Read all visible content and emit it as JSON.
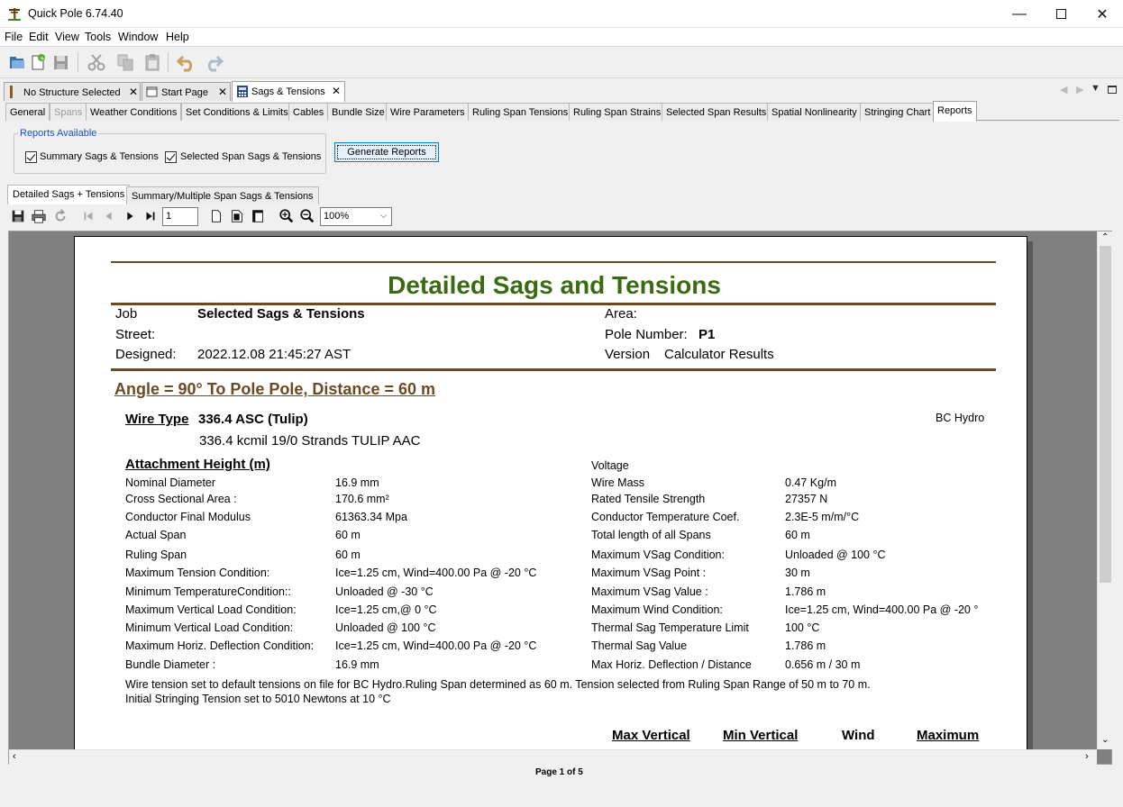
{
  "app": {
    "title": "Quick Pole 6.74.40"
  },
  "menu": [
    "File",
    "Edit",
    "View",
    "Tools",
    "Window",
    "Help"
  ],
  "doc_tabs": [
    {
      "label": "No Structure Selected"
    },
    {
      "label": "Start Page"
    },
    {
      "label": "Sags & Tensions",
      "active": true
    }
  ],
  "sub_tabs": [
    "General",
    "Spans",
    "Weather Conditions",
    "Set Conditions & Limits",
    "Cables",
    "Bundle Size",
    "Wire Parameters",
    "Ruling Span Tensions",
    "Ruling Span Strains",
    "Selected Span Results",
    "Spatial Nonlinearity",
    "Stringing Chart",
    "Reports"
  ],
  "reports_panel": {
    "legend": "Reports Available",
    "check1": "Summary Sags & Tensions",
    "check2": "Selected Span Sags & Tensions",
    "generate": "Generate Reports"
  },
  "report_tabs": [
    "Detailed Sags + Tensions",
    "Summary/Multiple Span Sags & Tensions"
  ],
  "viewer": {
    "page_input": "1",
    "zoom": "100%",
    "page_status": "Page 1 of 5"
  },
  "report": {
    "title": "Detailed Sags and Tensions",
    "job_label": "Job",
    "job_value": "Selected Sags & Tensions",
    "street_label": "Street:",
    "designed_label": "Designed:",
    "designed_value": "2022.12.08 21:45:27 AST",
    "area_label": "Area:",
    "pole_label": "Pole Number:",
    "pole_value": "P1",
    "version_label": "Version",
    "version_value": "Calculator Results",
    "angle_heading": "Angle = 90° To Pole Pole, Distance = 60 m",
    "wire_type_label": "Wire Type",
    "wire_type_value": "336.4 ASC (Tulip)",
    "wire_desc": "336.4 kcmil 19/0 Strands TULIP AAC",
    "utility": "BC Hydro",
    "attach_label": "Attachment Height (m)",
    "voltage_label": "Voltage",
    "left_rows": [
      [
        "Nominal Diameter",
        "16.9 mm"
      ],
      [
        "Cross Sectional Area :",
        "170.6 mm²"
      ],
      [
        "Conductor Final Modulus",
        "61363.34 Mpa"
      ],
      [
        "Actual Span",
        "60  m"
      ],
      [
        "Ruling Span",
        "60  m"
      ],
      [
        "Maximum Tension Condition:",
        "Ice=1.25 cm, Wind=400.00 Pa @ -20 °C"
      ],
      [
        "Minimum TemperatureCondition::",
        "Unloaded @ -30 °C"
      ],
      [
        "Maximum Vertical Load Condition:",
        "Ice=1.25 cm,@ 0 °C"
      ],
      [
        "Minimum Vertical Load Condition:",
        "Unloaded @ 100 °C"
      ],
      [
        "Maximum Horiz. Deflection Condition:",
        "Ice=1.25 cm, Wind=400.00 Pa @ -20 °C"
      ],
      [
        "Bundle Diameter :",
        "16.9 mm"
      ]
    ],
    "right_rows": [
      [
        "Wire Mass",
        "0.47 Kg/m"
      ],
      [
        "Rated Tensile Strength",
        "27357 N"
      ],
      [
        "Conductor Temperature Coef.",
        "2.3E-5 m/m/°C"
      ],
      [
        "Total length of all Spans",
        "60 m"
      ],
      [
        "Maximum VSag Condition:",
        "Unloaded @ 100 °C"
      ],
      [
        "Maximum VSag Point :",
        "30 m"
      ],
      [
        "Maximum VSag Value :",
        "1.786 m"
      ],
      [
        "Maximum Wind Condition:",
        "Ice=1.25 cm, Wind=400.00 Pa @ -20 °"
      ],
      [
        "Thermal Sag Temperature Limit",
        "100 °C"
      ],
      [
        "Thermal Sag Value",
        "1.786 m"
      ],
      [
        "Max Horiz. Deflection / Distance",
        "0.656 m      /     30 m"
      ]
    ],
    "note1": "Wire tension set to default tensions on file for BC Hydro.Ruling Span determined as 60 m. Tension selected from Ruling Span Range of 50 m to 70 m.",
    "note2": "Initial Stringing Tension set to 5010 Newtons at 10 °C",
    "col_heads": [
      "Max Vertical",
      "Min Vertical",
      "Wind",
      "Maximum"
    ]
  },
  "colors": {
    "title_green": "#3a6b12",
    "rule_brown": "#6b4a23",
    "heading_brown": "#6b4a23",
    "accent_blue": "#0078d7"
  }
}
